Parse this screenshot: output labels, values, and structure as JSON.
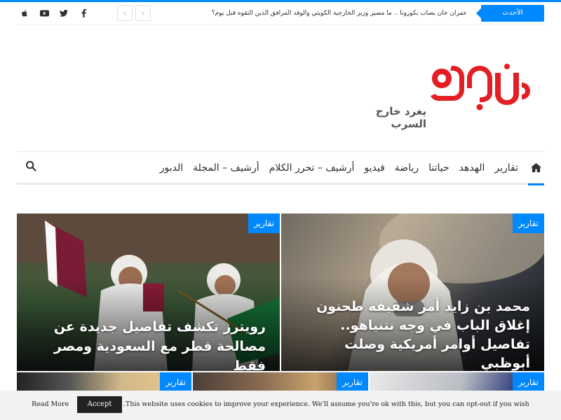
{
  "topbar": {
    "breaking_label": "الأحدث",
    "ticker_text": "عمران خان يصاب بكورونا .. ما مصير وزير الخارجية الكويتي والوفد المرافق الذين التقوه قبل يوم؟",
    "prev_arrow": "‹",
    "next_arrow": "›",
    "socials": [
      "facebook-icon",
      "twitter-icon",
      "youtube-icon",
      "apple-icon"
    ]
  },
  "logo": {
    "tagline": "يغرد خارج السرب",
    "brand_color": "#e31e24"
  },
  "nav": {
    "items": [
      "تقارير",
      "الهدهد",
      "حياتنا",
      "رياضة",
      "فيديو",
      "أرشيف – تحرر الكلام",
      "أرشيف – المجلة",
      "الدبور"
    ]
  },
  "featured": [
    {
      "category": "تقارير",
      "title": "محمد بن زايد أمر شقيقه طحنون إغلاق الباب في وجه نتنياهو.. تفاصيل أوامر أمريكية وصلت أبوظبي"
    },
    {
      "category": "تقارير",
      "title": "رويترز تكشف تفاصيل جديدة عن مصالحة قطر مع السعودية ومصر فقط"
    },
    {
      "category": "تقارير"
    },
    {
      "category": "تقارير"
    },
    {
      "category": "تقارير"
    }
  ],
  "cookie": {
    "text": ".This website uses cookies to improve your experience. We'll assume you're ok with this, but you can opt-out if you wish",
    "accept": "Accept",
    "read_more": "Read More"
  },
  "colors": {
    "accent": "#0088ff",
    "text": "#2c2f34"
  }
}
